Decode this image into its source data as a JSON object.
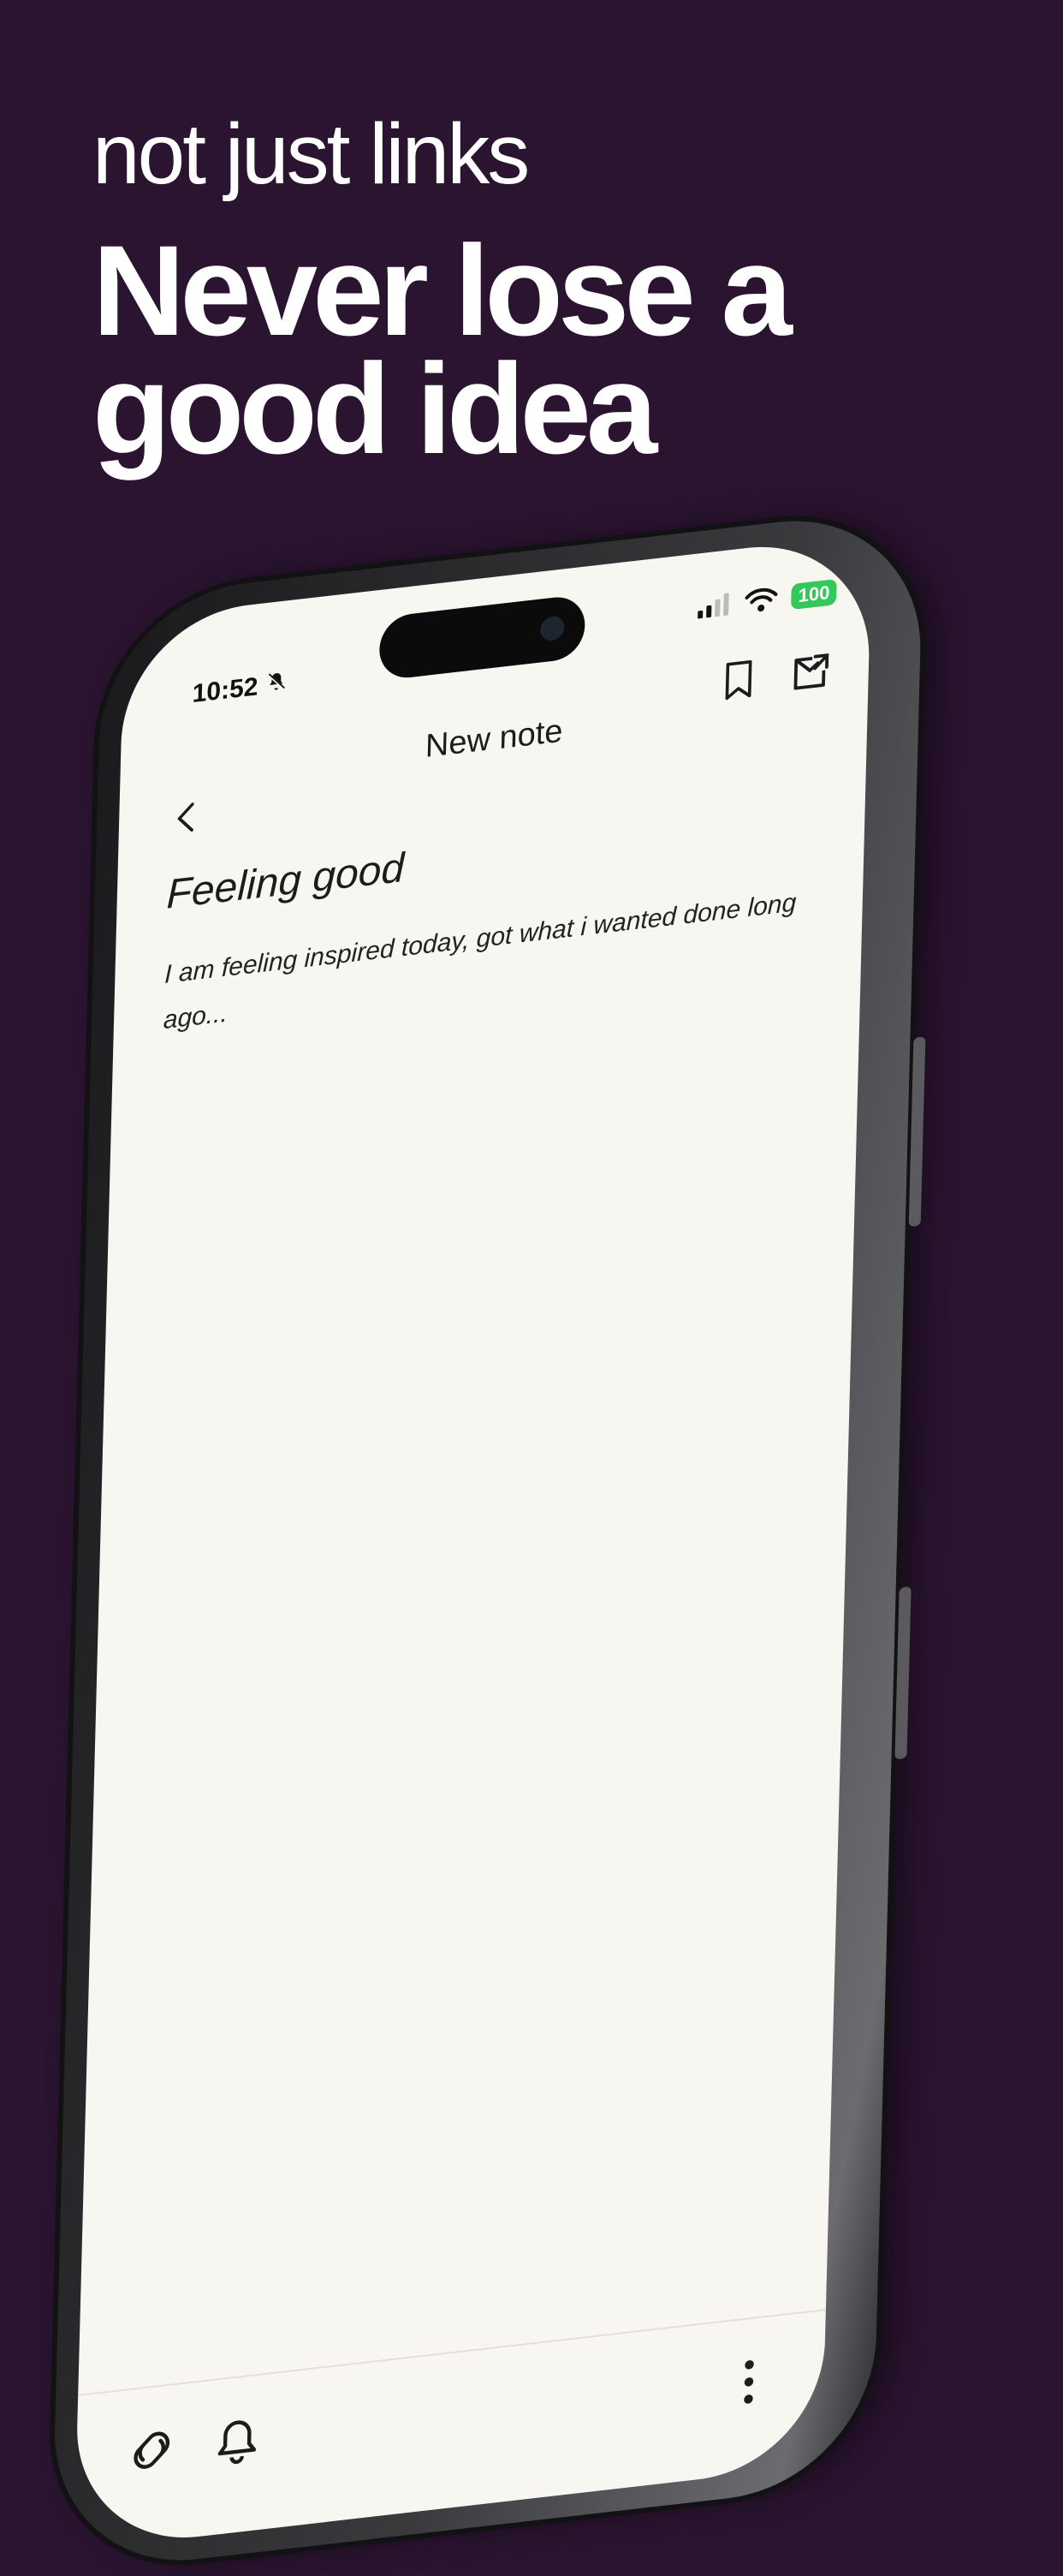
{
  "promo": {
    "subtitle": "not just links",
    "headline_line1": "Never lose a",
    "headline_line2": "good idea"
  },
  "status_bar": {
    "time": "10:52",
    "battery": "100",
    "icons": [
      "bell-slash-icon",
      "cellular-signal-icon",
      "wifi-icon",
      "battery-icon"
    ]
  },
  "header": {
    "title": "New note",
    "icons": [
      "back-chevron-icon",
      "bookmark-icon",
      "share-out-icon"
    ]
  },
  "note": {
    "title": "Feeling good",
    "body": "I am feeling inspired today, got what i wanted done long ago..."
  },
  "bottom_bar": {
    "icons": [
      "link-tag-icon",
      "bell-icon",
      "more-vertical-icon"
    ]
  },
  "colors": {
    "background": "#2a1430",
    "screen": "#f8f6f1",
    "battery": "#34c759"
  }
}
